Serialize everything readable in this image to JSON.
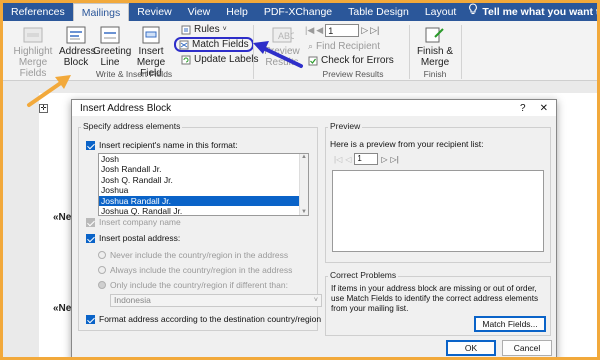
{
  "ribbon_tabs": [
    "References",
    "Mailings",
    "Review",
    "View",
    "Help",
    "PDF-XChange",
    "Table Design",
    "Layout"
  ],
  "tell_me": "Tell me what you want to",
  "ribbon": {
    "highlight_merge_fields": "Highlight\nMerge Fields",
    "address_block": "Address\nBlock",
    "greeting_line": "Greeting\nLine",
    "insert_merge_field": "Insert Merge\nField",
    "rules": "Rules",
    "match_fields": "Match Fields",
    "update_labels": "Update Labels",
    "preview_results": "Preview\nResults",
    "record_number": "1",
    "find_recipient": "Find Recipient",
    "check_for_errors": "Check for Errors",
    "finish_merge": "Finish &\nMerge",
    "group_write_insert": "Write & Insert Fields",
    "group_preview": "Preview Results",
    "group_finish": "Finish"
  },
  "document": {
    "merge_field_1": "«Ne",
    "merge_field_2": "«Ne"
  },
  "dialog": {
    "title": "Insert Address Block",
    "help": "?",
    "close": "✕",
    "specify_legend": "Specify address elements",
    "insert_name_label": "Insert recipient's name in this format:",
    "insert_name_checked": true,
    "name_formats": [
      "Josh",
      "Josh Randall Jr.",
      "Josh Q. Randall Jr.",
      "Joshua",
      "Joshua Randall Jr.",
      "Joshua Q. Randall Jr."
    ],
    "selected_format_index": 4,
    "insert_company_label": "Insert company name",
    "insert_company_checked": true,
    "insert_postal_label": "Insert postal address:",
    "insert_postal_checked": true,
    "never_include": "Never include the country/region in the address",
    "always_include": "Always include the country/region in the address",
    "only_include": "Only include the country/region if different than:",
    "country_value": "Indonesia",
    "format_address_label": "Format address according to the destination country/region",
    "format_address_checked": true,
    "preview_legend": "Preview",
    "preview_hint": "Here is a preview from your recipient list:",
    "preview_record": "1",
    "correct_legend": "Correct Problems",
    "correct_text": "If items in your address block are missing or out of order, use Match Fields to identify the correct address elements from your mailing list.",
    "match_fields_button": "Match Fields...",
    "ok_button": "OK",
    "cancel_button": "Cancel"
  },
  "colors": {
    "ribbon_blue": "#2b579a",
    "highlight_blue": "#2e2ec9",
    "annotation_orange": "#f2a93b",
    "selection_blue": "#0a63c8"
  }
}
